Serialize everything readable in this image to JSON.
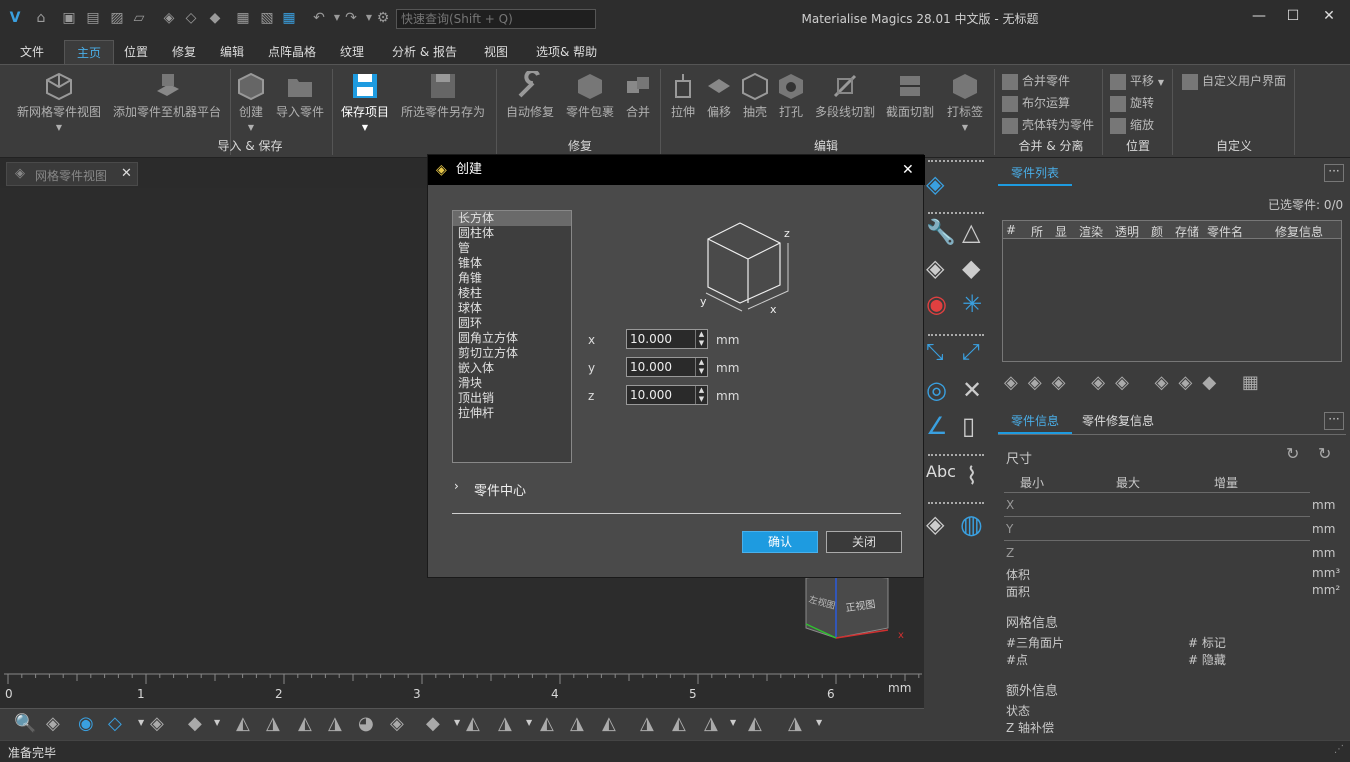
{
  "app": {
    "title": "Materialise Magics 28.01 中文版 - 无标题",
    "search_placeholder": "快速查询(Shift + Q)",
    "window_controls": [
      "minimize",
      "maximize",
      "close"
    ]
  },
  "menu": {
    "items": [
      "文件",
      "主页",
      "位置",
      "修复",
      "编辑",
      "点阵晶格",
      "纹理",
      "分析 & 报告",
      "视图",
      "选项& 帮助"
    ],
    "active": "主页"
  },
  "ribbon": {
    "import_save": {
      "label": "导入 & 保存",
      "buttons": [
        "新网格零件视图",
        "添加零件至机器平台",
        "创建",
        "导入零件",
        "保存项目",
        "所选零件另存为"
      ]
    },
    "repair": {
      "label": "修复",
      "buttons": [
        "自动修复",
        "零件包裹",
        "合并"
      ]
    },
    "edit": {
      "label": "编辑",
      "buttons": [
        "拉伸",
        "偏移",
        "抽壳",
        "打孔",
        "多段线切割",
        "截面切割",
        "打标签"
      ]
    },
    "merge_split": {
      "label": "合并 & 分离",
      "buttons": [
        "合并零件",
        "布尔运算",
        "壳体转为零件"
      ]
    },
    "position": {
      "label": "位置",
      "buttons": [
        "平移",
        "旋转",
        "缩放"
      ]
    },
    "custom": {
      "label": "自定义",
      "buttons": [
        "自定义用户界面"
      ]
    }
  },
  "viewtab": {
    "label": "网格零件视图"
  },
  "viewcube": {
    "left": "左视图",
    "front": "正视图",
    "x_axis": "x"
  },
  "ruler": {
    "ticks": [
      "0",
      "1",
      "2",
      "3",
      "4",
      "5",
      "6"
    ],
    "unit": "mm"
  },
  "dialog": {
    "title": "创建",
    "shapes": [
      "长方体",
      "圆柱体",
      "管",
      "锥体",
      "角锥",
      "棱柱",
      "球体",
      "圆环",
      "圆角立方体",
      "剪切立方体",
      "嵌入体",
      "滑块",
      "顶出销",
      "拉伸杆"
    ],
    "selected_shape": "长方体",
    "preview_axes": {
      "x": "x",
      "y": "y",
      "z": "z"
    },
    "fields": [
      {
        "label": "x",
        "value": "10.000",
        "unit": "mm"
      },
      {
        "label": "y",
        "value": "10.000",
        "unit": "mm"
      },
      {
        "label": "z",
        "value": "10.000",
        "unit": "mm"
      }
    ],
    "part_center": "零件中心",
    "ok": "确认",
    "close": "关闭"
  },
  "right_panel": {
    "part_list_tab": "零件列表",
    "selected_parts": "已选零件: 0/0",
    "columns": [
      "#",
      "所",
      "显",
      "渲染",
      "透明",
      "颜",
      "存储",
      "零件名",
      "修复信息"
    ],
    "part_info_tab": "零件信息",
    "part_repair_tab": "零件修复信息",
    "size_label": "尺寸",
    "size_cols": [
      "最小",
      "最大",
      "增量"
    ],
    "size_rows": [
      {
        "axis": "X",
        "unit": "mm"
      },
      {
        "axis": "Y",
        "unit": "mm"
      },
      {
        "axis": "Z",
        "unit": "mm"
      }
    ],
    "volume": "体积",
    "volume_unit": "mm³",
    "area": "面积",
    "area_unit": "mm²",
    "mesh_info": "网格信息",
    "triangles": "#三角面片",
    "markers": "# 标记",
    "points": "#点",
    "hidden": "# 隐藏",
    "extra_info": "额外信息",
    "status": "状态",
    "z_comp": "Z 轴补偿"
  },
  "status": {
    "text": "准备完毕"
  },
  "colors": {
    "accent": "#1e9be0",
    "active_tab_text": "#4aaee8",
    "dialog_bg": "#4a4a4a",
    "ribbon_bg": "#3c3c3c"
  }
}
